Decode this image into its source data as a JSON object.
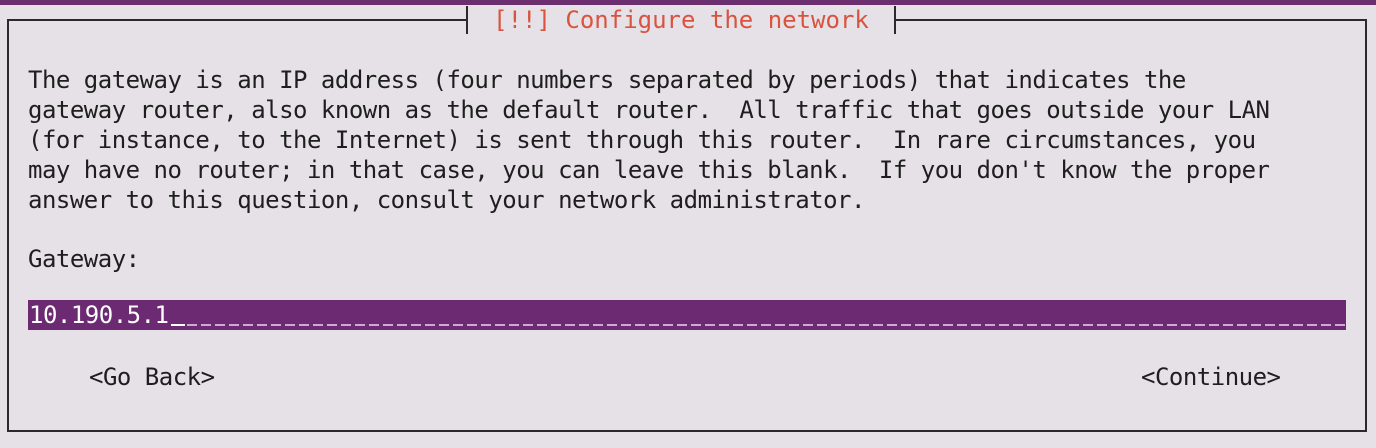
{
  "dialog": {
    "title": "[!!] Configure the network",
    "description": "The gateway is an IP address (four numbers separated by periods) that indicates the\ngateway router, also known as the default router.  All traffic that goes outside your LAN\n(for instance, to the Internet) is sent through this router.  In rare circumstances, you\nmay have no router; in that case, you can leave this blank.  If you don't know the proper\nanswer to this question, consult your network administrator.",
    "field_label": "Gateway:",
    "field_value": "10.190.5.1",
    "buttons": {
      "back": "<Go Back>",
      "continue": "<Continue>"
    }
  },
  "colors": {
    "background": "#e5e1e6",
    "accent": "#6b2a72",
    "title": "#d9533f",
    "text": "#1e1e1e"
  }
}
